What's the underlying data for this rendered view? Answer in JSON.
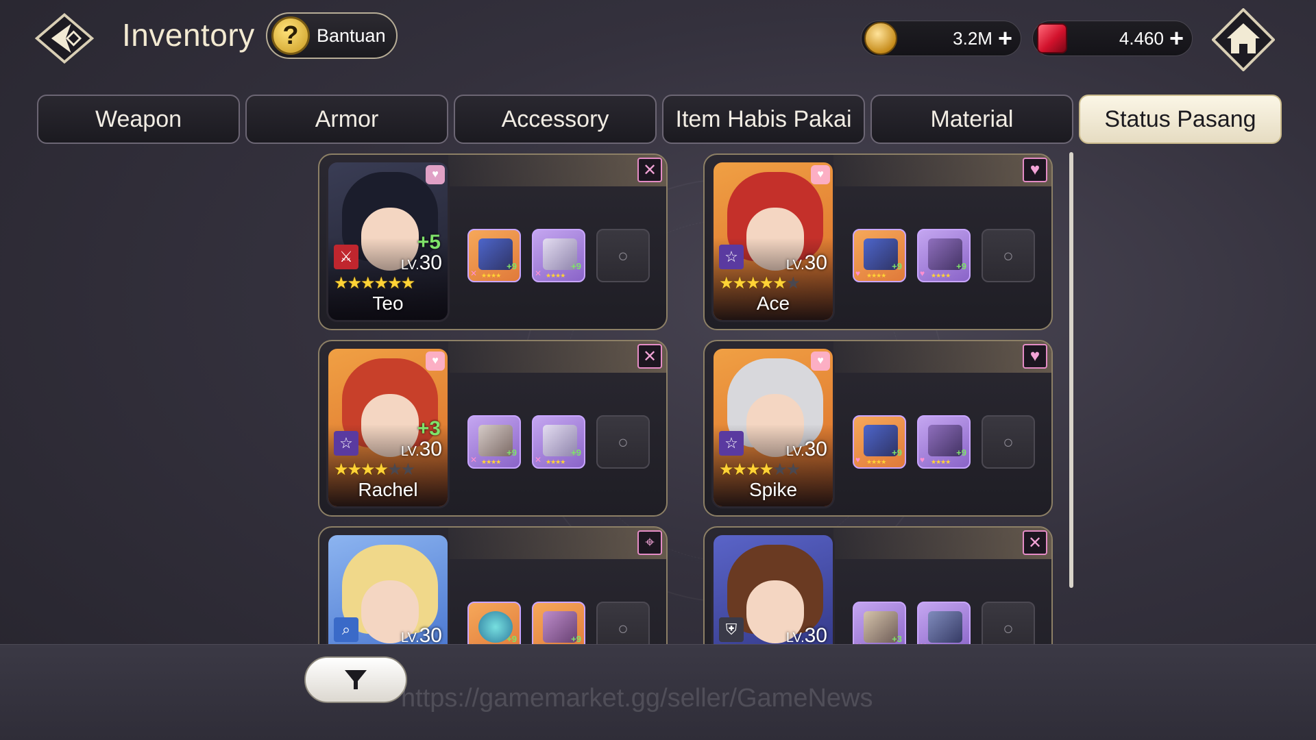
{
  "header": {
    "title": "Inventory",
    "help_label": "Bantuan",
    "gold_value": "3.2M",
    "gem_value": "4.460",
    "plus": "+"
  },
  "tabs": [
    {
      "label": "Weapon",
      "active": false
    },
    {
      "label": "Armor",
      "active": false
    },
    {
      "label": "Accessory",
      "active": false
    },
    {
      "label": "Item Habis Pakai",
      "active": false
    },
    {
      "label": "Material",
      "active": false
    },
    {
      "label": "Status Pasang",
      "active": true
    }
  ],
  "heroes": [
    {
      "name": "Teo",
      "level": "30",
      "lv_prefix": "LV.",
      "enhance": "+5",
      "stars": 6,
      "max_stars": 6,
      "role_icon": "no-sword-icon",
      "class_icon": "sword-icon",
      "item1_enh": "+9",
      "item2_enh": "+9"
    },
    {
      "name": "Ace",
      "level": "30",
      "lv_prefix": "LV.",
      "enhance": "",
      "stars": 5,
      "max_stars": 6,
      "role_icon": "heart-icon",
      "class_icon": "star-icon",
      "item1_enh": "+9",
      "item2_enh": "+9"
    },
    {
      "name": "Rachel",
      "level": "30",
      "lv_prefix": "LV.",
      "enhance": "+3",
      "stars": 4,
      "max_stars": 6,
      "role_icon": "no-sword-icon",
      "class_icon": "star-icon",
      "item1_enh": "+9",
      "item2_enh": "+9"
    },
    {
      "name": "Spike",
      "level": "30",
      "lv_prefix": "LV.",
      "enhance": "",
      "stars": 4,
      "max_stars": 6,
      "role_icon": "heart-icon",
      "class_icon": "star-icon",
      "item1_enh": "+9",
      "item2_enh": "+9"
    },
    {
      "name": "",
      "level": "30",
      "lv_prefix": "LV.",
      "enhance": "",
      "stars": 0,
      "max_stars": 0,
      "role_icon": "crosshair-icon",
      "class_icon": "magnify-icon",
      "item1_enh": "+9",
      "item2_enh": "+9"
    },
    {
      "name": "",
      "level": "30",
      "lv_prefix": "LV.",
      "enhance": "",
      "stars": 0,
      "max_stars": 0,
      "role_icon": "no-sword-icon",
      "class_icon": "shield-icon",
      "item1_enh": "+3",
      "item2_enh": ""
    }
  ],
  "watermark": "https://gamemarket.gg/seller/GameNews",
  "colors": {
    "accent_gold": "#c9b98a",
    "star": "#ffd336",
    "enhance_green": "#7fe36a",
    "role_pink": "#e58cc6"
  }
}
